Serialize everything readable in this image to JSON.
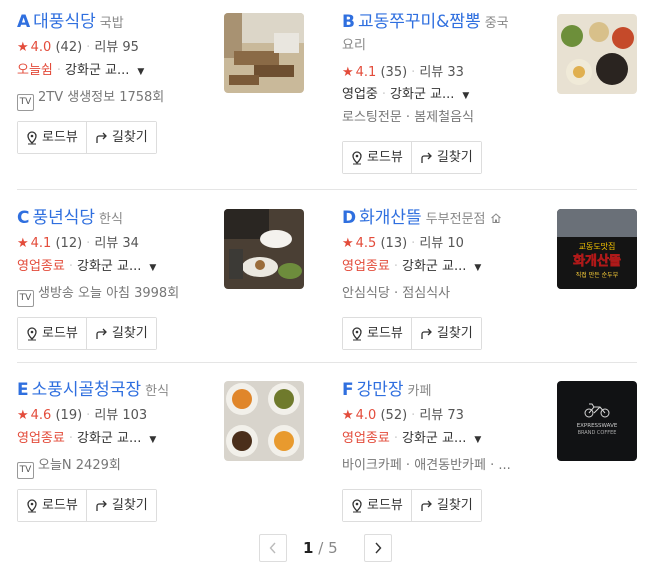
{
  "places": [
    {
      "letter": "A",
      "name": "대풍식당",
      "category": "국밥",
      "rating": "4.0",
      "review_count": "(42)",
      "reviews": "리뷰 95",
      "status": "오늘쉼",
      "address": "강화군 교...",
      "sub": "2TV 생생정보 1758회",
      "has_tv": true
    },
    {
      "letter": "B",
      "name": "교동쭈꾸미&짬뽕",
      "category": "중국",
      "category2": "요리",
      "rating": "4.1",
      "review_count": "(35)",
      "reviews": "리뷰 33",
      "status": "영업중",
      "address": "강화군 교...",
      "sub": "로스팅전문 · 봄제철음식",
      "has_tv": false
    },
    {
      "letter": "C",
      "name": "풍년식당",
      "category": "한식",
      "rating": "4.1",
      "review_count": "(12)",
      "reviews": "리뷰 34",
      "status": "영업종료",
      "address": "강화군 교...",
      "sub": "생방송 오늘 아침 3998회",
      "has_tv": true
    },
    {
      "letter": "D",
      "name": "화개산뜰",
      "category": "두부전문점",
      "rating": "4.5",
      "review_count": "(13)",
      "reviews": "리뷰 10",
      "status": "영업종료",
      "address": "강화군 교...",
      "sub": "안심식당 · 점심식사",
      "has_tv": false
    },
    {
      "letter": "E",
      "name": "소풍시골청국장",
      "category": "한식",
      "rating": "4.6",
      "review_count": "(19)",
      "reviews": "리뷰 103",
      "status": "영업종료",
      "address": "강화군 교...",
      "sub": "오늘N 2429회",
      "has_tv": true
    },
    {
      "letter": "F",
      "name": "강만장",
      "category": "카페",
      "rating": "4.0",
      "review_count": "(52)",
      "reviews": "리뷰 73",
      "status": "영업종료",
      "address": "강화군 교...",
      "sub": "바이크카페 · 애견동반카페 · ...",
      "has_tv": false
    }
  ],
  "buttons": {
    "roadview": "로드뷰",
    "directions": "길찾기"
  },
  "tv_label": "TV",
  "pagination": {
    "current": "1",
    "total": "5",
    "separator": "/"
  },
  "thumb_texts": {
    "d_line1": "교동도맛집",
    "d_line2": "화개산뜰",
    "d_line3": "직접 만든 순두부",
    "f_line1": "EXPRESSWAVE",
    "f_line2": "BRAND COFFEE"
  },
  "colors": {
    "accent": "#2f6fdf",
    "red": "#e34c3b",
    "gray": "#888888"
  }
}
